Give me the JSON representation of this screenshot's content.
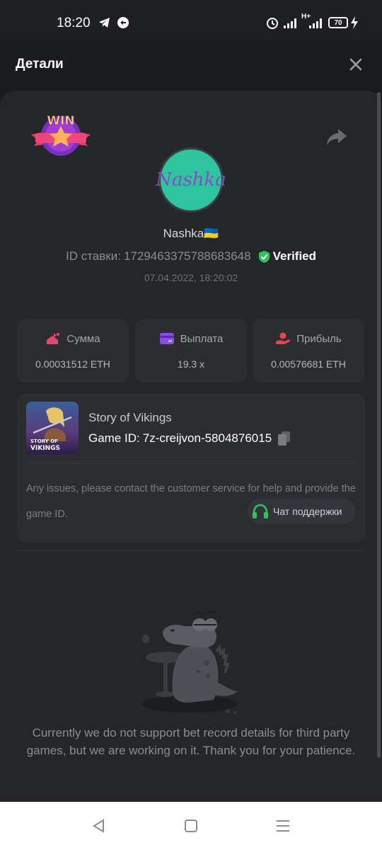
{
  "status_bar": {
    "time": "18:20",
    "battery": "70",
    "network": "H+",
    "icons": [
      "telegram-icon",
      "whatsapp-icon",
      "alarm-icon",
      "signal-icon",
      "battery-icon",
      "charging-icon"
    ]
  },
  "header": {
    "title": "Детали",
    "close_icon": "close-icon"
  },
  "bet": {
    "win_badge": "WIN",
    "avatar_text": "Nashka",
    "username": "Nashka🇺🇦",
    "bet_id_label": "ID ставки:",
    "bet_id": "1729463375788683648",
    "verified": "Verified",
    "datetime": "07.04.2022, 18:20:02"
  },
  "stats": [
    {
      "icon": "sum-icon",
      "label": "Сумма",
      "value": "0.00031512 ETH",
      "color": "#e8456b"
    },
    {
      "icon": "card-icon",
      "label": "Выплата",
      "value": "19.3 x",
      "color": "#8a4de8"
    },
    {
      "icon": "profit-icon",
      "label": "Прибыль",
      "value": "0.00576681 ETH",
      "color": "#e84545"
    }
  ],
  "game": {
    "name": "Story of Vikings",
    "id_label": "Game ID:",
    "id_value": "7z-creijvon-5804876015",
    "thumb_line1": "STORY OF",
    "thumb_line2": "VIKINGS",
    "issues_text": "Any issues, please contact the customer service for help and provide the game ID.",
    "support_label": "Чат поддержки"
  },
  "notice": "Currently we do not support bet record details for third party games, but we are working on it. Thank you for your patience.",
  "nav": [
    "back-icon",
    "home-icon",
    "menu-icon"
  ],
  "colors": {
    "background": "#1a1b1e",
    "panel": "#24262a",
    "card": "#2b2d31",
    "verified_green": "#2ec45a",
    "avatar_bg": "#2ec4a0",
    "support_green": "#2ec45a"
  }
}
